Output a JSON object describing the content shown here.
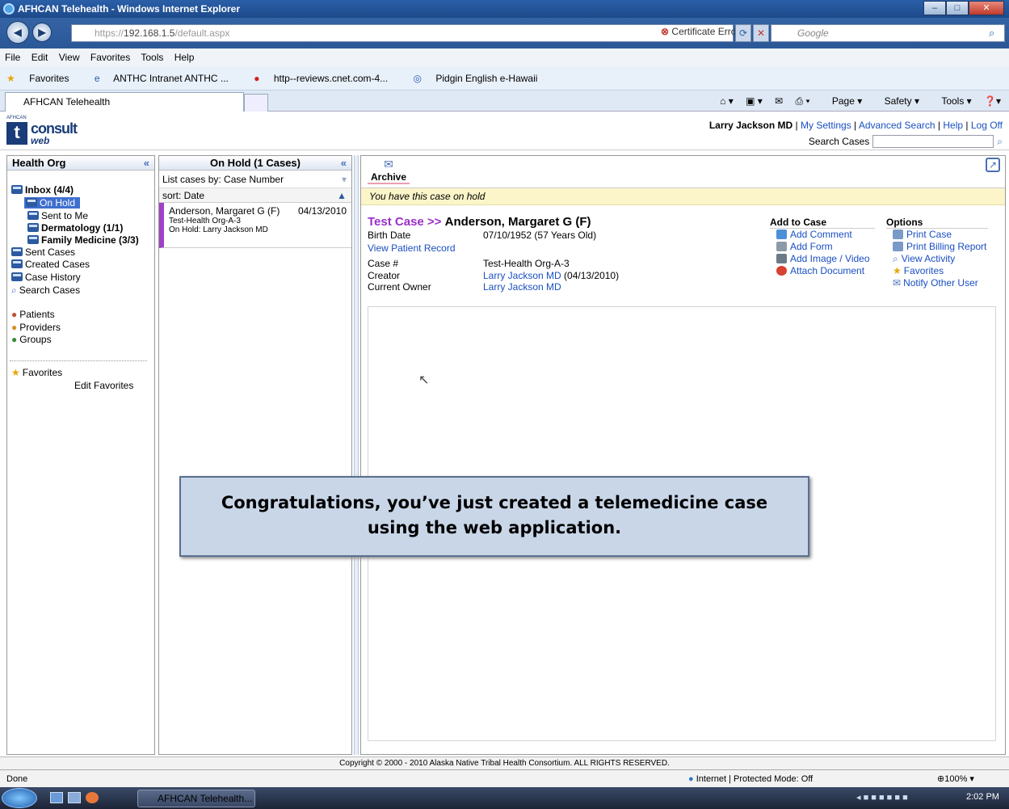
{
  "browser": {
    "window_title": "AFHCAN Telehealth - Windows Internet Explorer",
    "url_scheme": "https://",
    "url_host": "192.168.1.5",
    "url_path": "/default.aspx",
    "cert_error": "Certificate Error",
    "search_placeholder": "Google",
    "menu": [
      "File",
      "Edit",
      "View",
      "Favorites",
      "Tools",
      "Help"
    ],
    "favorites_label": "Favorites",
    "favorites_links": [
      "ANTHC Intranet ANTHC ...",
      "http--reviews.cnet.com-4...",
      "Pidgin English e-Hawaii"
    ],
    "tab_title": "AFHCAN Telehealth",
    "command_bar": [
      "Page",
      "Safety",
      "Tools"
    ]
  },
  "app": {
    "logo_small": "AFHCAN",
    "logo_main": "consult",
    "logo_sub": "web",
    "user_name": "Larry Jackson MD",
    "links": [
      "My Settings",
      "Advanced Search",
      "Help",
      "Log Off"
    ],
    "search_label": "Search Cases"
  },
  "left_panel": {
    "title": "Health Org",
    "inbox": "Inbox (4/4)",
    "on_hold": "On Hold",
    "sent_to_me": "Sent to Me",
    "dermatology": "Dermatology (1/1)",
    "family_medicine": "Family Medicine (3/3)",
    "sent_cases": "Sent Cases",
    "created_cases": "Created Cases",
    "case_history": "Case History",
    "search_cases": "Search Cases",
    "patients": "Patients",
    "providers": "Providers",
    "groups": "Groups",
    "favorites": "Favorites",
    "edit_favorites": "Edit Favorites"
  },
  "middle_panel": {
    "title": "On Hold (1 Cases)",
    "list_by": "List cases by: Case Number",
    "sort": "sort: Date",
    "case": {
      "name": "Anderson, Margaret G (F)",
      "date": "04/13/2010",
      "org": "Test-Health Org-A-3",
      "hold": "On Hold: Larry Jackson MD"
    }
  },
  "case_panel": {
    "archive_label": "Archive",
    "hold_notice": "You have this case on hold",
    "case_prefix": "Test Case >>",
    "patient_name": "Anderson, Margaret G (F)",
    "birth_date_label": "Birth Date",
    "birth_date": "07/10/1952 (57 Years Old)",
    "view_record": "View Patient Record",
    "case_no_label": "Case #",
    "case_no": "Test-Health Org-A-3",
    "creator_label": "Creator",
    "creator": "Larry Jackson MD",
    "creator_date": "(04/13/2010)",
    "owner_label": "Current Owner",
    "owner": "Larry Jackson MD",
    "add_to_case_title": "Add to Case",
    "add_to_case": [
      "Add Comment",
      "Add Form",
      "Add Image / Video",
      "Attach Document"
    ],
    "options_title": "Options",
    "options": [
      "Print Case",
      "Print Billing Report",
      "View Activity",
      "Favorites",
      "Notify Other User"
    ]
  },
  "overlay": {
    "line1": "Congratulations, you’ve just created a telemedicine case",
    "line2": "using the web application."
  },
  "footer": "Copyright © 2000 - 2010 Alaska Native Tribal Health Consortium. ALL RIGHTS RESERVED.",
  "status": {
    "left": "Done",
    "zone": "Internet | Protected Mode: Off",
    "zoom": "100%"
  },
  "taskbar": {
    "item": "AFHCAN Telehealth...",
    "time": "2:02 PM"
  }
}
